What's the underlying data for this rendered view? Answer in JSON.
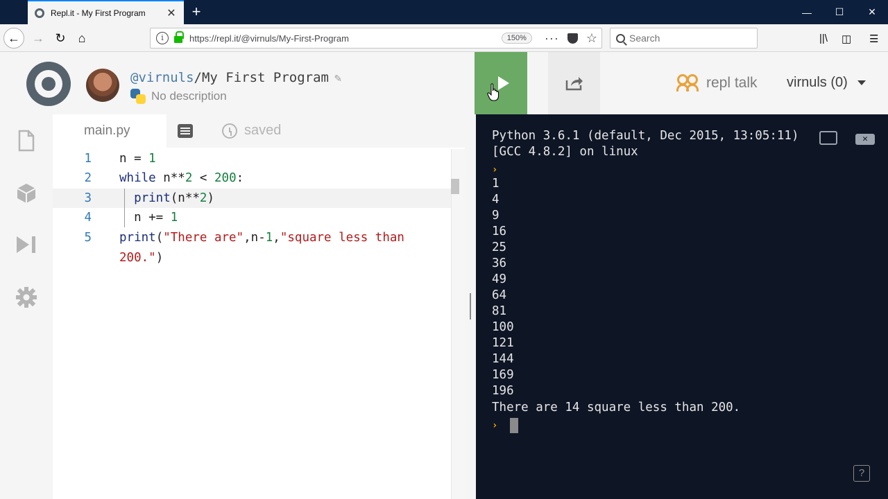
{
  "browser": {
    "tab_title": "Repl.it - My First Program",
    "url": "https://repl.it/@virnuls/My-First-Program",
    "zoom": "150%",
    "search_placeholder": "Search",
    "new_tab": "+",
    "tab_close": "✕"
  },
  "header": {
    "user_handle": "@virnuls",
    "separator": "/",
    "project_name": "My First Program",
    "description": "No description",
    "repl_talk_label": "repl talk",
    "user_menu_label": "virnuls (0)"
  },
  "editor": {
    "file_tab": "main.py",
    "save_status": "saved",
    "active_line": 3,
    "lines": [
      {
        "num": "1",
        "code": "n = 1"
      },
      {
        "num": "2",
        "code": "while n**2 < 200:"
      },
      {
        "num": "3",
        "code": "  print(n**2)"
      },
      {
        "num": "4",
        "code": "  n += 1"
      },
      {
        "num": "5",
        "code": "print(\"There are\",n-1,\"square less than"
      },
      {
        "num": "",
        "code": "200.\")"
      }
    ]
  },
  "console": {
    "lines": [
      "Python 3.6.1 (default, Dec 2015, 13:05:11)",
      "[GCC 4.8.2] on linux",
      "1",
      "4",
      "9",
      "16",
      "25",
      "36",
      "49",
      "64",
      "81",
      "100",
      "121",
      "144",
      "169",
      "196",
      "There are 14 square less than 200."
    ],
    "prompt_glyph": "›",
    "help_label": "?",
    "close_label": "✕"
  },
  "colors": {
    "run_button": "#6aaa64",
    "console_bg": "#0e1525",
    "accent_orange": "#e8a23a"
  },
  "icons": [
    "repl-logo-icon",
    "python-icon",
    "pencil-icon",
    "run-icon",
    "share-icon",
    "repl-talk-icon",
    "files-icon",
    "packages-icon",
    "debugger-icon",
    "settings-icon",
    "format-icon",
    "history-icon",
    "help-icon"
  ]
}
